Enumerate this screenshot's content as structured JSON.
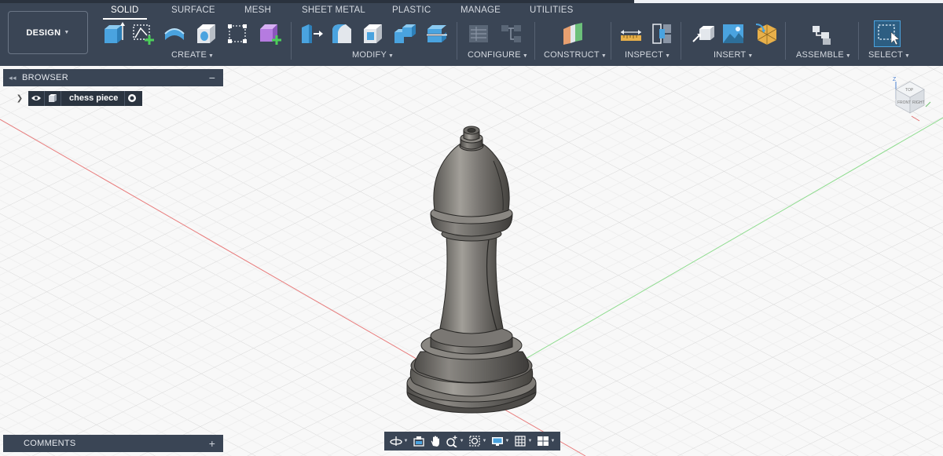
{
  "workspace": {
    "label": "DESIGN"
  },
  "tabs": [
    {
      "label": "SOLID",
      "active": true
    },
    {
      "label": "SURFACE"
    },
    {
      "label": "MESH"
    },
    {
      "label": "SHEET METAL"
    },
    {
      "label": "PLASTIC"
    },
    {
      "label": "MANAGE"
    },
    {
      "label": "UTILITIES"
    }
  ],
  "groups": {
    "create": "CREATE",
    "modify": "MODIFY",
    "configure": "CONFIGURE",
    "construct": "CONSTRUCT",
    "inspect": "INSPECT",
    "insert": "INSERT",
    "assemble": "ASSEMBLE",
    "select": "SELECT"
  },
  "browser": {
    "title": "BROWSER",
    "items": [
      {
        "label": "chess piece"
      }
    ]
  },
  "comments": {
    "title": "COMMENTS"
  },
  "viewcube": {
    "top_face": "TOP",
    "front_face": "FRONT",
    "right_face": "RIGHT",
    "axis_label": "Z"
  },
  "colors": {
    "toolbar": "#3a4555",
    "accent_blue": "#4aa3df",
    "green_plus": "#4ccf5a",
    "purple": "#b57be0",
    "grid_red_axis": "#e06a6a",
    "grid_green_axis": "#6ad06a",
    "model": "#6f6d69"
  },
  "icons": [
    "extrude-icon",
    "create-sketch-icon",
    "revolve-icon",
    "hole-icon",
    "dimension-sketch-icon",
    "form-icon",
    "press-pull-icon",
    "fillet-icon",
    "shell-icon",
    "combine-icon",
    "split-body-icon",
    "parameters-icon",
    "configuration-icon",
    "offset-plane-icon",
    "measure-icon",
    "interference-icon",
    "insert-derive-icon",
    "decal-icon",
    "insert-mesh-icon",
    "joint-icon",
    "select-window-icon"
  ]
}
